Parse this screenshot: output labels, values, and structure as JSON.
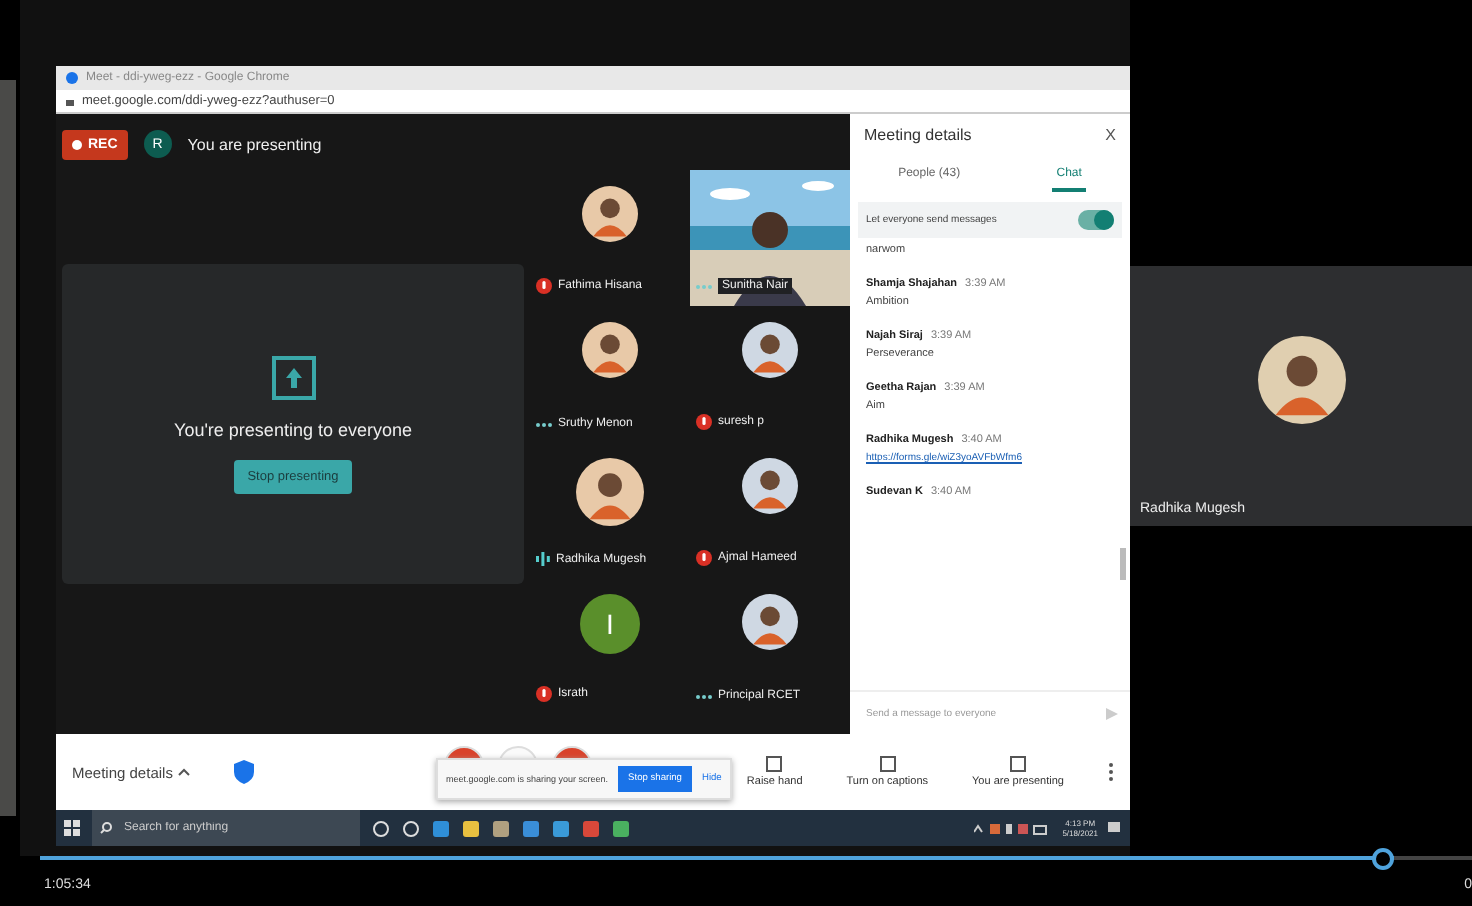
{
  "browser": {
    "title": "Meet - ddi-yweg-ezz - Google Chrome",
    "url": "meet.google.com/ddi-yweg-ezz?authuser=0"
  },
  "top_bar": {
    "rec": "REC",
    "avatar_letter": "R",
    "status": "You are presenting"
  },
  "presentation": {
    "message": "You're presenting to everyone",
    "button": "Stop presenting"
  },
  "participants": [
    {
      "name": "Fathima Hisana",
      "muted": true
    },
    {
      "name": "Sunitha Nair",
      "muted": false,
      "speaking": false,
      "kind": "video"
    },
    {
      "name": "Sruthy Menon",
      "muted": false,
      "speaking": false
    },
    {
      "name": "suresh p",
      "muted": true
    },
    {
      "name": "Radhika Mugesh",
      "muted": false,
      "speaking": true
    },
    {
      "name": "Ajmal Hameed",
      "muted": true
    },
    {
      "name": "Israth",
      "muted": true,
      "kind": "letter",
      "letter": "I",
      "color": "#5a8f2b"
    },
    {
      "name": "Principal RCET",
      "muted": false,
      "speaking": false
    }
  ],
  "chat_panel": {
    "title": "Meeting details",
    "close": "X",
    "tabs": [
      {
        "label": "People (43)",
        "selected": false
      },
      {
        "label": "Chat",
        "selected": true
      }
    ],
    "toggle": {
      "label": "Let everyone send messages",
      "on": true
    },
    "messages": [
      {
        "text": "narwom"
      },
      {
        "sender": "Shamja Shajahan",
        "time": "3:39 AM",
        "text": "Ambition"
      },
      {
        "sender": "Najah Siraj",
        "time": "3:39 AM",
        "text": "Perseverance"
      },
      {
        "sender": "Geetha Rajan",
        "time": "3:39 AM",
        "text": "Aim"
      },
      {
        "sender": "Radhika Mugesh",
        "time": "3:40 AM",
        "link": "https://forms.gle/wiZ3yoAVFbWfm6"
      },
      {
        "sender": "Sudevan K",
        "time": "3:40 AM"
      }
    ],
    "input": {
      "placeholder": "Send a message to everyone"
    }
  },
  "bottom_bar": {
    "details": "Meeting details",
    "share_notice": "meet.google.com is sharing your screen.",
    "stop_sharing": "Stop sharing",
    "hide": "Hide",
    "actions": [
      "Raise hand",
      "Turn on captions",
      "You are presenting"
    ]
  },
  "taskbar": {
    "search": {
      "placeholder": "Search for anything"
    },
    "time": "4:13 PM",
    "date": "5/18/2021"
  },
  "side_tile": {
    "name": "Radhika Mugesh"
  },
  "player": {
    "level": 0.945,
    "elapsed": "1:05:34",
    "duration": "0"
  }
}
